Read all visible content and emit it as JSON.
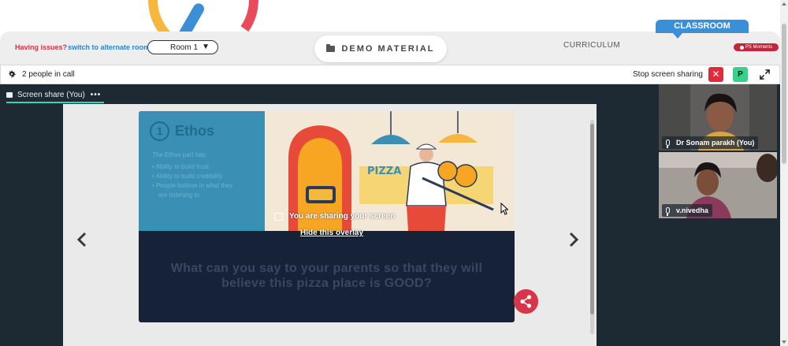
{
  "header": {
    "classroom_tab": "CLASSROOM",
    "issues_text": "Having issues?",
    "switch_link": "switch to alternate room",
    "room_selected": "Room 1",
    "demo_material": "DEMO MATERIAL",
    "curriculum": "CURRICULUM",
    "moments_badge": "PS Moments"
  },
  "callbar": {
    "people_count": "2 people in call",
    "stop_sharing": "Stop screen sharing",
    "p_button": "P"
  },
  "stage": {
    "share_tab": "Screen share (You)",
    "share_tab_more": "•••",
    "overlay_message": "You are sharing your screen",
    "hide_overlay": "Hide this overlay"
  },
  "slide": {
    "number": "1",
    "title": "Ethos",
    "intro": "The Ethos part has:",
    "bullets": [
      "Ability to build trust",
      "Ability to build credibility",
      "People believe in what they",
      "are listening to"
    ],
    "question": "What can you say to your parents so that they will believe this pizza place is GOOD?",
    "sign_text": "PIZZA"
  },
  "participants": [
    {
      "name": "Dr Sonam parakh (You)"
    },
    {
      "name": "v.nivedha"
    }
  ],
  "colors": {
    "stop_button": "#e12b3b",
    "p_button": "#35d28c",
    "classroom_tab": "#3b8fd6",
    "moments_badge": "#c2263a",
    "stage_bg": "#1e2a33"
  }
}
